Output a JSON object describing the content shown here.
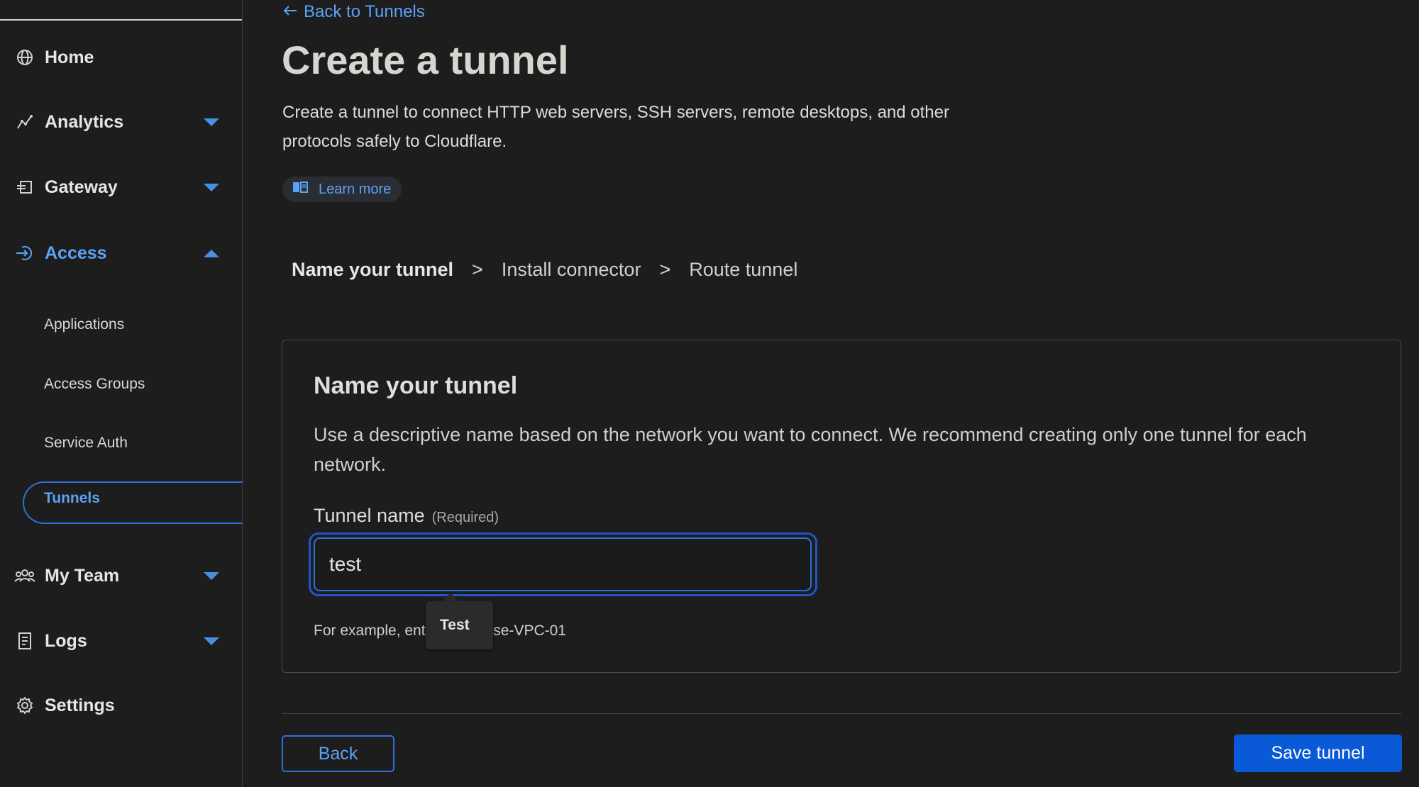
{
  "sidebar": {
    "home": {
      "label": "Home"
    },
    "analytics": {
      "label": "Analytics"
    },
    "gateway": {
      "label": "Gateway"
    },
    "access": {
      "label": "Access"
    },
    "access_items": [
      {
        "label": "Applications"
      },
      {
        "label": "Access Groups"
      },
      {
        "label": "Service Auth"
      },
      {
        "label": "Tunnels"
      }
    ],
    "my_team": {
      "label": "My Team"
    },
    "logs": {
      "label": "Logs"
    },
    "settings": {
      "label": "Settings"
    }
  },
  "main": {
    "back_link": "Back to Tunnels",
    "title": "Create a tunnel",
    "description": "Create a tunnel to connect HTTP web servers, SSH servers, remote desktops, and other protocols safely to Cloudflare.",
    "learn_more": "Learn more",
    "steps": [
      "Name your tunnel",
      "Install connector",
      "Route tunnel"
    ],
    "step_separator": ">"
  },
  "card": {
    "title": "Name your tunnel",
    "description": "Use a descriptive name based on the network you want to connect. We recommend creating only one tunnel for each network.",
    "field_label": "Tunnel name",
    "field_required": "(Required)",
    "input_value": "test",
    "helper_text": "For example, enter enterprise-VPC-01",
    "autocomplete_suggestion": "Test"
  },
  "footer": {
    "back_label": "Back",
    "save_label": "Save tunnel"
  },
  "colors": {
    "accent": "#5aa2f5",
    "primary_button": "#0a59d6",
    "background": "#1d1d1d"
  }
}
